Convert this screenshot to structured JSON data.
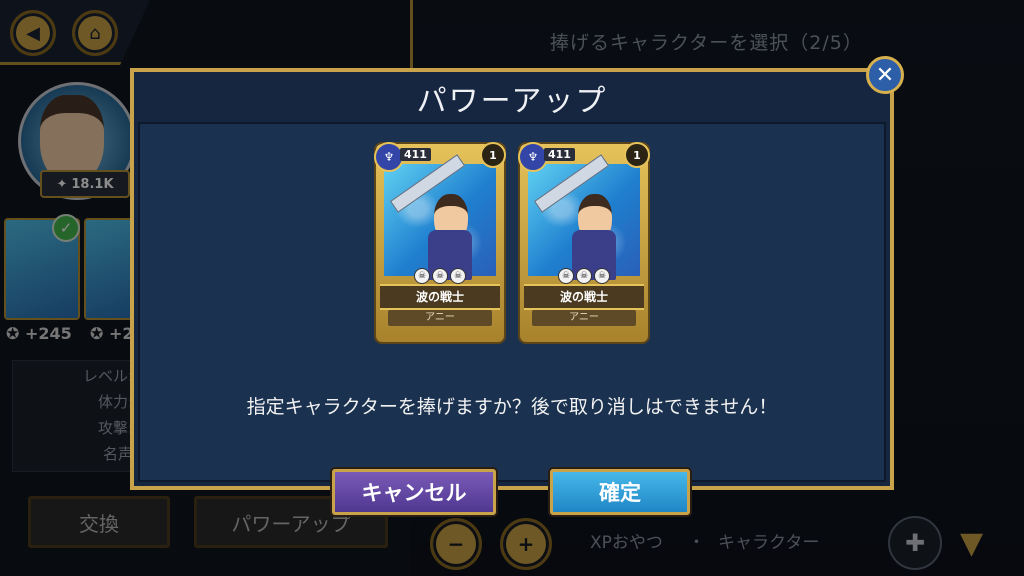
{
  "header": {
    "title": "捧げるキャラクターを選択（2/5）"
  },
  "nav": {
    "back_icon": "back-arrow-icon",
    "home_icon": "home-icon"
  },
  "character_panel": {
    "power": "18.1K",
    "bonus_values": [
      "+245",
      "+2"
    ],
    "stat_labels": [
      "レベル:",
      "体力:",
      "攻撃:",
      "名声"
    ]
  },
  "bottom_bar": {
    "exchange_label": "交換",
    "powerup_label": "パワーアップ",
    "tabs": [
      "XPおやつ",
      "・",
      "キャラクター"
    ]
  },
  "modal": {
    "title": "パワーアップ",
    "message": "指定キャラクターを捧げますか？後で取り消しはできません！",
    "cancel_label": "キャンセル",
    "confirm_label": "確定",
    "cards": [
      {
        "xp": "411",
        "level": "1",
        "name": "波の戦士",
        "character": "アニー",
        "element": "water"
      },
      {
        "xp": "411",
        "level": "1",
        "name": "波の戦士",
        "character": "アニー",
        "element": "water"
      }
    ]
  },
  "colors": {
    "gold": "#c9a34a",
    "modal_bg": "#162640",
    "cancel_button": "#6a4aa8",
    "confirm_button": "#2f9fd8"
  }
}
